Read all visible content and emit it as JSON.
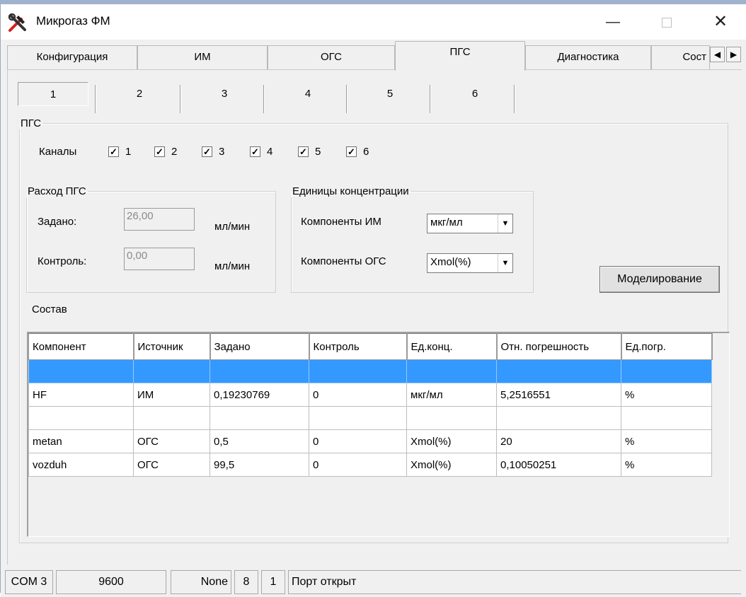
{
  "window": {
    "title": "Микрогаз ФМ"
  },
  "tabs": [
    {
      "label": "Конфигурация"
    },
    {
      "label": "ИМ"
    },
    {
      "label": "ОГС"
    },
    {
      "label": "ПГС"
    },
    {
      "label": "Диагностика"
    },
    {
      "label": "Сост"
    }
  ],
  "subtabs": [
    "1",
    "2",
    "3",
    "4",
    "5",
    "6"
  ],
  "pgs": {
    "group_title": "ПГС",
    "channels_label": "Каналы",
    "channels": [
      {
        "label": "1",
        "checked": true
      },
      {
        "label": "2",
        "checked": true
      },
      {
        "label": "3",
        "checked": true
      },
      {
        "label": "4",
        "checked": true
      },
      {
        "label": "5",
        "checked": true
      },
      {
        "label": "6",
        "checked": true
      }
    ],
    "flow": {
      "title": "Расход ПГС",
      "set_label": "Задано:",
      "set_value": "26,00",
      "set_unit": "мл/мин",
      "ctrl_label": "Контроль:",
      "ctrl_value": "0,00",
      "ctrl_unit": "мл/мин"
    },
    "units": {
      "title": "Единицы концентрации",
      "im_label": "Компоненты ИМ",
      "im_value": "мкг/мл",
      "ogs_label": "Компоненты ОГС",
      "ogs_value": "Xmol(%)"
    },
    "model_button": "Моделирование",
    "composition_label": "Состав"
  },
  "table": {
    "columns": [
      "Компонент",
      "Источник",
      "Задано",
      "Контроль",
      "Ед.конц.",
      "Отн. погрешность",
      "Ед.погр."
    ],
    "rows": [
      [
        "",
        "",
        "",
        "",
        "",
        "",
        ""
      ],
      [
        "HF",
        "ИМ",
        "0,19230769",
        "0",
        "мкг/мл",
        "5,2516551",
        "%"
      ],
      [
        "",
        "",
        "",
        "",
        "",
        "",
        ""
      ],
      [
        "metan",
        "ОГС",
        "0,5",
        "0",
        "Xmol(%)",
        "20",
        "%"
      ],
      [
        "vozduh",
        "ОГС",
        "99,5",
        "0",
        "Xmol(%)",
        "0,10050251",
        "%"
      ]
    ],
    "selected_row": 0
  },
  "status": {
    "port": "COM 3",
    "baud": "9600",
    "parity": "None",
    "databits": "8",
    "stopbits": "1",
    "message": "Порт открыт"
  },
  "colors": {
    "selection": "#3399ff",
    "face": "#f0f0f0"
  }
}
